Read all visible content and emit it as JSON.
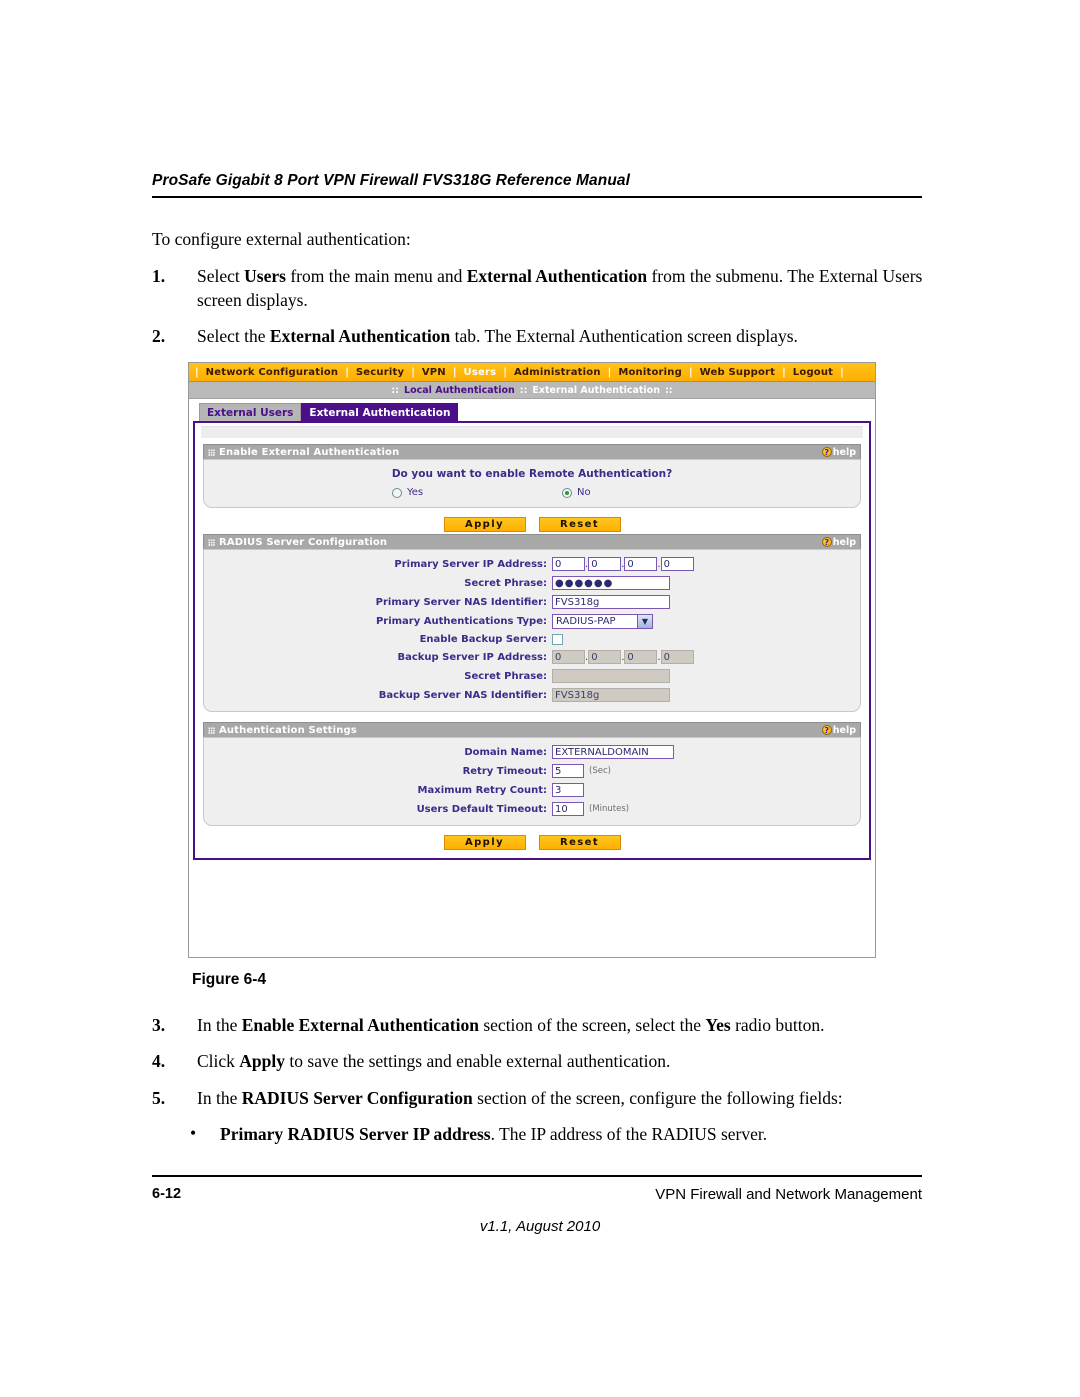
{
  "document": {
    "running_header": "ProSafe Gigabit 8 Port VPN Firewall FVS318G Reference Manual",
    "intro": "To configure external authentication:",
    "steps": [
      {
        "num": "1.",
        "html": "Select <b>Users</b> from the main menu and <b>External Authentication</b> from the submenu. The External Users screen displays."
      },
      {
        "num": "2.",
        "html": "Select the <b>External Authentication</b> tab. The External Authentication screen displays."
      }
    ],
    "figure_caption": "Figure 6-4",
    "steps_after": [
      {
        "num": "3.",
        "html": "In the <b>Enable External Authentication</b> section of the screen, select the <b>Yes</b> radio button."
      },
      {
        "num": "4.",
        "html": "Click <b>Apply</b> to save the settings and enable external authentication."
      },
      {
        "num": "5.",
        "html": "In the <b>RADIUS Server Configuration</b> section of the screen, configure the following fields:"
      }
    ],
    "bullets": [
      {
        "bullet": "•",
        "html": "<b>Primary RADIUS Server IP address</b>. The IP address of the RADIUS server."
      }
    ],
    "footer": {
      "page_number": "6-12",
      "chapter": "VPN Firewall and Network Management",
      "version": "v1.1, August 2010"
    }
  },
  "screenshot": {
    "navbar": {
      "separator": "|",
      "items": [
        {
          "label": "Network Configuration",
          "active": false
        },
        {
          "label": "Security",
          "active": false
        },
        {
          "label": "VPN",
          "active": false
        },
        {
          "label": "Users",
          "active": true
        },
        {
          "label": "Administration",
          "active": false
        },
        {
          "label": "Monitoring",
          "active": false
        },
        {
          "label": "Web Support",
          "active": false
        },
        {
          "label": "Logout",
          "active": false
        }
      ]
    },
    "submenu": {
      "marker": "::",
      "items": [
        {
          "label": "Local Authentication",
          "state": "link"
        },
        {
          "label": "External Authentication",
          "state": "current"
        }
      ]
    },
    "tabs": [
      {
        "label": "External Users",
        "active": false
      },
      {
        "label": "External Authentication",
        "active": true
      }
    ],
    "help_label": "help",
    "help_glyph": "?",
    "section_enable": {
      "title": "Enable External Authentication",
      "question": "Do you want to enable Remote Authentication?",
      "options": [
        {
          "label": "Yes",
          "selected": false
        },
        {
          "label": "No",
          "selected": true
        }
      ]
    },
    "buttons_top": {
      "apply": "Apply",
      "reset": "Reset"
    },
    "section_radius": {
      "title": "RADIUS Server Configuration",
      "primary_ip_label": "Primary Server IP Address:",
      "primary_ip": [
        "0",
        "0",
        "0",
        "0"
      ],
      "ip_dot": ".",
      "secret_label": "Secret Phrase:",
      "secret_value": "●●●●●●",
      "nas_label": "Primary Server NAS Identifier:",
      "nas_value": "FVS318g",
      "authtype_label": "Primary Authentications Type:",
      "authtype_value": "RADIUS-PAP",
      "authtype_arrow": "▼",
      "enable_backup_label": "Enable Backup Server:",
      "enable_backup_checked": false,
      "backup_ip_label": "Backup Server IP Address:",
      "backup_ip": [
        "0",
        "0",
        "0",
        "0"
      ],
      "backup_secret_label": "Secret Phrase:",
      "backup_secret_value": "",
      "backup_nas_label": "Backup Server NAS Identifier:",
      "backup_nas_value": "FVS318g"
    },
    "section_authsettings": {
      "title": "Authentication Settings",
      "domain_label": "Domain Name:",
      "domain_value": "EXTERNALDOMAIN",
      "retry_timeout_label": "Retry Timeout:",
      "retry_timeout_value": "5",
      "retry_timeout_units": "(Sec)",
      "max_retry_label": "Maximum Retry Count:",
      "max_retry_value": "3",
      "users_timeout_label": "Users Default Timeout:",
      "users_timeout_value": "10",
      "users_timeout_units": "(Minutes)"
    },
    "buttons_bottom": {
      "apply": "Apply",
      "reset": "Reset"
    }
  },
  "colors": {
    "nav_orange": "#ffae00",
    "accent_purple": "#4b0f8a",
    "label_purple": "#3d2b8a",
    "section_header_grey": "#a8a8a8",
    "section_body_grey": "#efefef",
    "button_yellow": "#ffb000",
    "radio_selected_green": "#2e9b2e",
    "disabled_field": "#cfcbc3"
  }
}
